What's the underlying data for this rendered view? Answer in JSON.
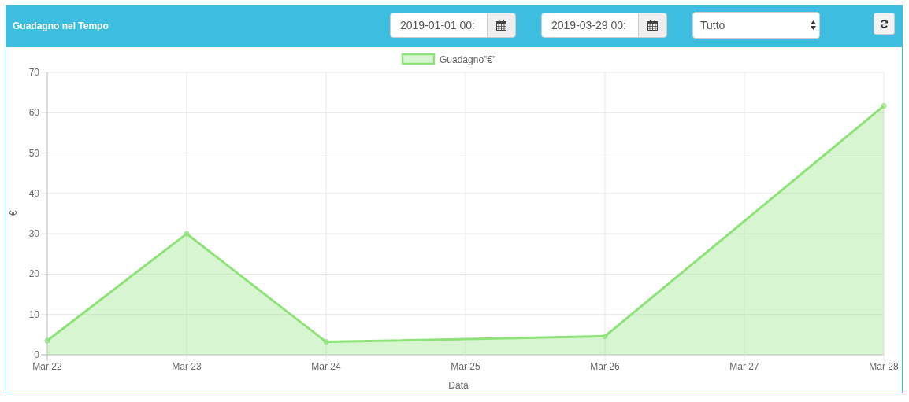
{
  "panel": {
    "title": "Guadagno nel Tempo",
    "date_from": {
      "value": "2019-01-01 00:"
    },
    "date_to": {
      "value": "2019-03-29 00:"
    },
    "filter": {
      "value": "Tutto"
    },
    "chart_data": {
      "type": "area",
      "xlabel": "Data",
      "ylabel": "€",
      "categories": [
        "Mar 22",
        "Mar 23",
        "Mar 24",
        "Mar 25",
        "Mar 26",
        "Mar 27",
        "Mar 28"
      ],
      "series": [
        {
          "name": "Guadagno\"€\"",
          "color": "#8fe27a",
          "values": [
            3.5,
            30,
            3.2,
            null,
            4.6,
            null,
            61.7
          ]
        }
      ],
      "ylim": [
        0,
        70
      ],
      "grid": true,
      "yticks": [
        0,
        10,
        20,
        30,
        40,
        50,
        60,
        70
      ]
    }
  }
}
